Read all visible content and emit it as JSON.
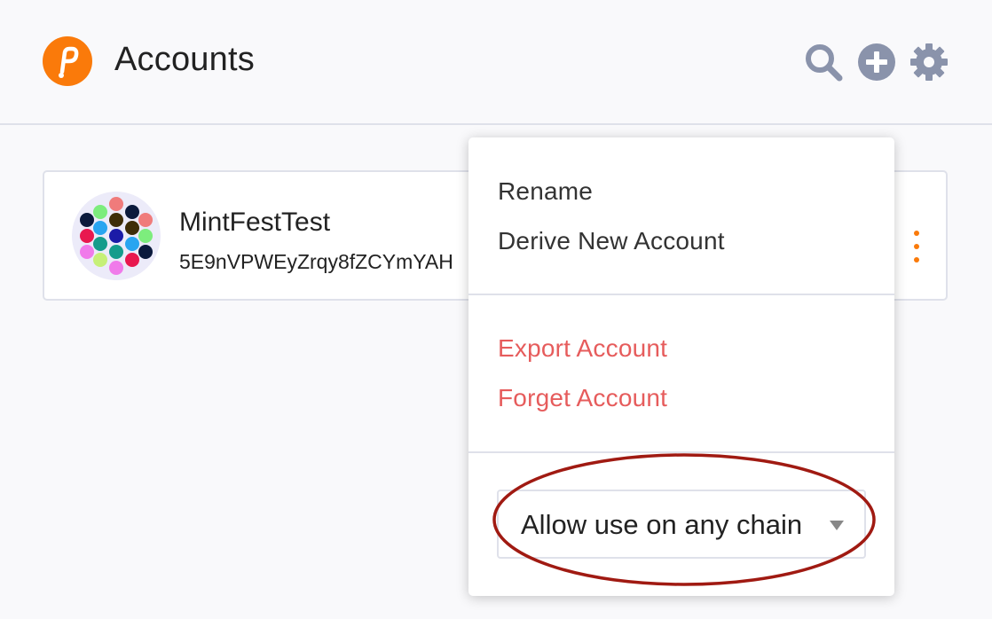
{
  "header": {
    "title": "Accounts",
    "icons": [
      "polkadot-logo-icon",
      "search-icon",
      "add-circle-icon",
      "gear-icon"
    ]
  },
  "account": {
    "name": "MintFestTest",
    "address": "5E9nVPWEyZrqy8fZCYmYAH"
  },
  "menu": {
    "rename": "Rename",
    "derive": "Derive New Account",
    "export": "Export Account",
    "forget": "Forget Account",
    "chain_select": {
      "selected": "Allow use on any chain"
    }
  },
  "colors": {
    "brand": "#fa7a0a",
    "danger": "#e65c5c",
    "icon_gray": "#8a93ab",
    "highlight": "#a01a12"
  }
}
